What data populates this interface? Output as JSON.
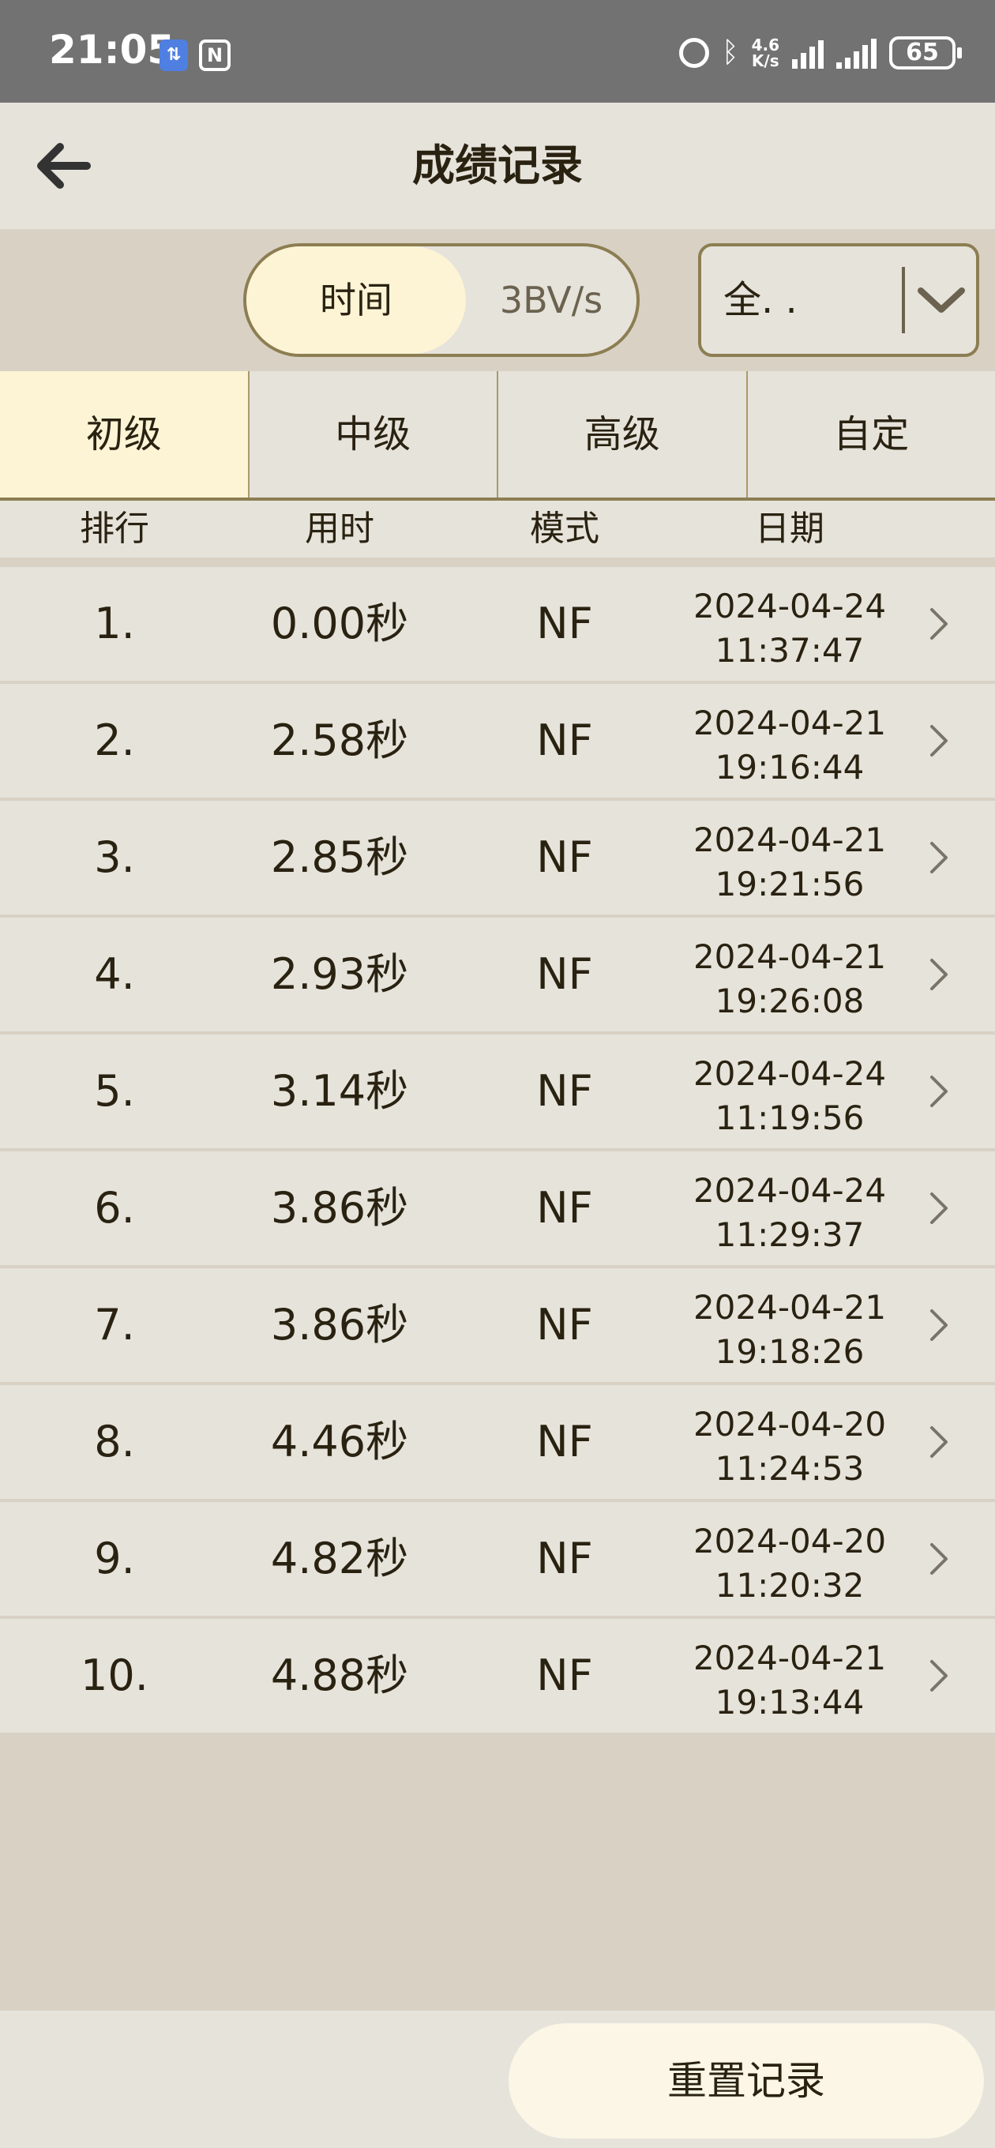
{
  "status_bar": {
    "time": "21:05",
    "net_speed_value": "4.6",
    "net_speed_unit": "K/s",
    "battery": "65"
  },
  "header": {
    "title": "成绩记录"
  },
  "filters": {
    "mode_options": [
      "时间",
      "3BV/s"
    ],
    "mode_selected": "时间",
    "scope_value": "全. ."
  },
  "level_tabs": [
    {
      "label": "初级",
      "active": true
    },
    {
      "label": "中级",
      "active": false
    },
    {
      "label": "高级",
      "active": false
    },
    {
      "label": "自定",
      "active": false
    }
  ],
  "table": {
    "columns": [
      "排行",
      "用时",
      "模式",
      "日期"
    ],
    "rows": [
      {
        "rank": "1.",
        "time": "0.00秒",
        "mode": "NF",
        "date": "2024-04-24",
        "clock": "11:37:47"
      },
      {
        "rank": "2.",
        "time": "2.58秒",
        "mode": "NF",
        "date": "2024-04-21",
        "clock": "19:16:44"
      },
      {
        "rank": "3.",
        "time": "2.85秒",
        "mode": "NF",
        "date": "2024-04-21",
        "clock": "19:21:56"
      },
      {
        "rank": "4.",
        "time": "2.93秒",
        "mode": "NF",
        "date": "2024-04-21",
        "clock": "19:26:08"
      },
      {
        "rank": "5.",
        "time": "3.14秒",
        "mode": "NF",
        "date": "2024-04-24",
        "clock": "11:19:56"
      },
      {
        "rank": "6.",
        "time": "3.86秒",
        "mode": "NF",
        "date": "2024-04-24",
        "clock": "11:29:37"
      },
      {
        "rank": "7.",
        "time": "3.86秒",
        "mode": "NF",
        "date": "2024-04-21",
        "clock": "19:18:26"
      },
      {
        "rank": "8.",
        "time": "4.46秒",
        "mode": "NF",
        "date": "2024-04-20",
        "clock": "11:24:53"
      },
      {
        "rank": "9.",
        "time": "4.82秒",
        "mode": "NF",
        "date": "2024-04-20",
        "clock": "11:20:32"
      },
      {
        "rank": "10.",
        "time": "4.88秒",
        "mode": "NF",
        "date": "2024-04-21",
        "clock": "19:13:44"
      }
    ]
  },
  "footer": {
    "reset_label": "重置记录"
  },
  "colors": {
    "accent_border": "#8c7e52",
    "selected_bg": "#fdf4d6",
    "surface": "#e6e3db",
    "background": "#d8d1c4",
    "text": "#2a2211"
  }
}
